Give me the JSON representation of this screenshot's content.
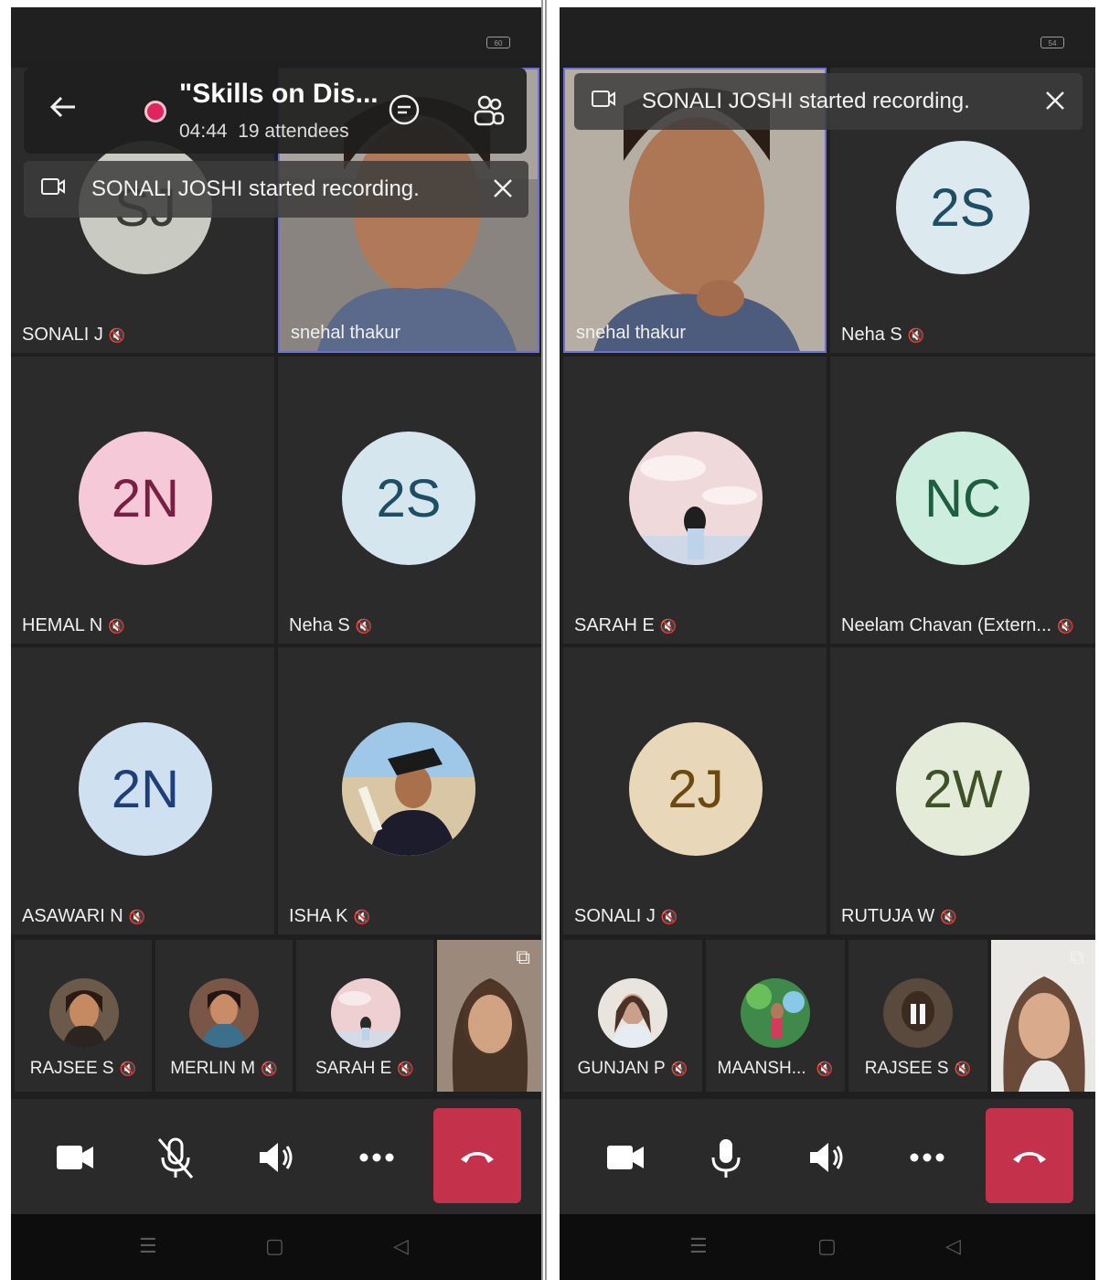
{
  "left": {
    "battery": "60",
    "meeting": {
      "title": "\"Skills on Dis...",
      "duration": "04:44",
      "attendees": "19 attendees"
    },
    "notification": "SONALI JOSHI started recording.",
    "tiles": [
      {
        "name": "SONALI J",
        "initials": "SJ",
        "bg": "#c9cbc2",
        "fg": "#3a3d37"
      },
      {
        "name": "snehal thakur",
        "video": true
      },
      {
        "name": "HEMAL N",
        "initials": "2N",
        "bg": "#f6c9d8",
        "fg": "#7a1f44"
      },
      {
        "name": "Neha S",
        "initials": "2S",
        "bg": "#d6e6ee",
        "fg": "#1d4e63"
      },
      {
        "name": "ASAWARI N",
        "initials": "2N",
        "bg": "#cfe0f1",
        "fg": "#1f3f78"
      },
      {
        "name": "ISHA K",
        "photo": "graduation-photo"
      }
    ],
    "small": [
      {
        "name": "RAJSEE S"
      },
      {
        "name": "MERLIN M"
      },
      {
        "name": "SARAH E"
      }
    ]
  },
  "right": {
    "battery": "54",
    "notification": "SONALI JOSHI started recording.",
    "tiles": [
      {
        "name": "snehal thakur",
        "video": true
      },
      {
        "name": "Neha S",
        "initials": "2S",
        "bg": "#dce9ef",
        "fg": "#1d4e63"
      },
      {
        "name": "SARAH E",
        "photo": "sky-illustration"
      },
      {
        "name": "Neelam Chavan (Extern...",
        "initials": "NC",
        "bg": "#cdeede",
        "fg": "#1e5d3f"
      },
      {
        "name": "SONALI J",
        "initials": "2J",
        "bg": "#e8d7b8",
        "fg": "#6a4a12"
      },
      {
        "name": "RUTUJA W",
        "initials": "2W",
        "bg": "#e4ecd9",
        "fg": "#3f5128"
      }
    ],
    "small": [
      {
        "name": "GUNJAN P"
      },
      {
        "name": "MAANSH..."
      },
      {
        "name": "RAJSEE S"
      }
    ]
  },
  "colors": {
    "end_call": "#c4314b",
    "recording": "#e0245e",
    "active_speaker_border": "#6b6fd6"
  }
}
